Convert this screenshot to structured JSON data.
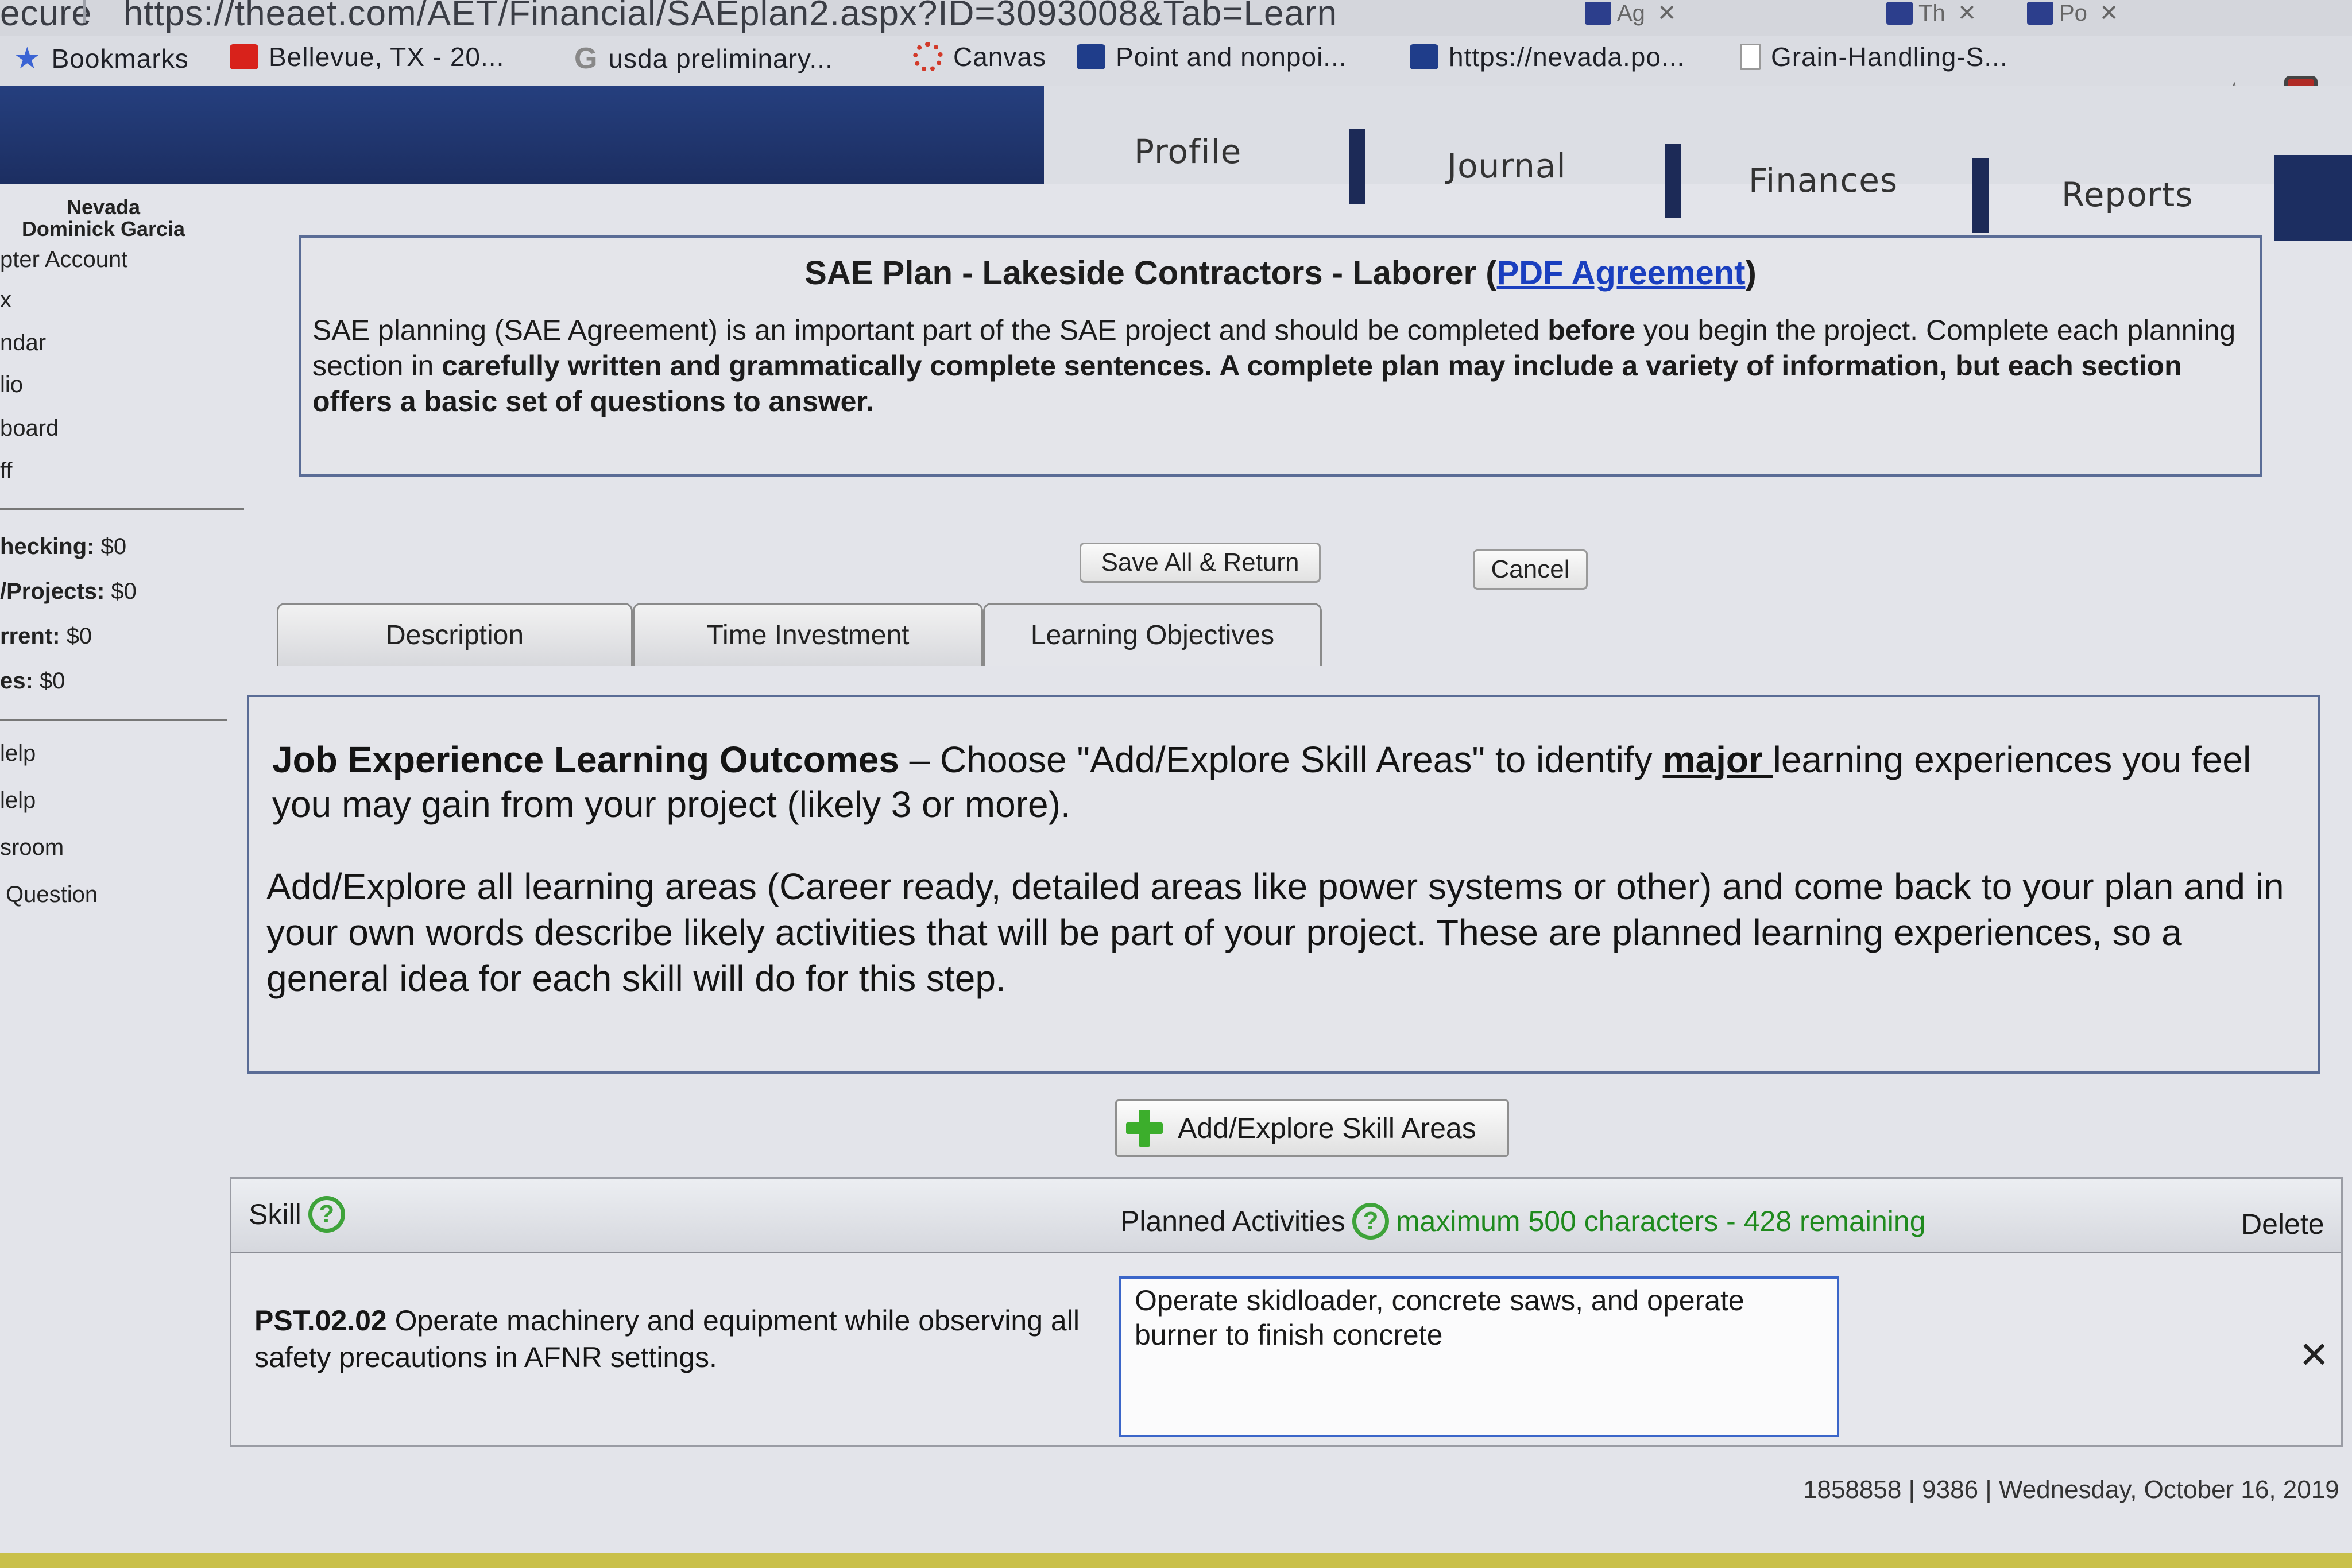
{
  "browser": {
    "url": "https://theaet.com/AET/Financial/SAEplan2.aspx?ID=3093008&Tab=Learn",
    "url_prefix": "ecure",
    "tabs": [
      "Ag",
      "Th",
      "Po"
    ],
    "bookmarks": [
      {
        "label": "Bookmarks",
        "icon": "star-icon"
      },
      {
        "label": "Bellevue, TX - 20...",
        "icon": "youtube-icon"
      },
      {
        "label": "usda preliminary...",
        "icon": "google-icon"
      },
      {
        "label": "Canvas",
        "icon": "canvas-icon"
      },
      {
        "label": "Point and nonpoi...",
        "icon": "site-icon"
      },
      {
        "label": "https://nevada.po...",
        "icon": "site-icon"
      },
      {
        "label": "Grain-Handling-S...",
        "icon": "page-icon"
      }
    ]
  },
  "nav": {
    "tabs": [
      "Profile",
      "Journal",
      "Finances",
      "Reports"
    ]
  },
  "sidebar": {
    "user_line1": "Nevada",
    "user_line2": "Dominick Garcia",
    "links": [
      "pter Account",
      "x",
      "ndar",
      "lio",
      "board",
      "ff"
    ],
    "balances": [
      {
        "label": "hecking:",
        "value": "$0"
      },
      {
        "label": "/Projects:",
        "value": "$0"
      },
      {
        "label": "rrent:",
        "value": "$0"
      },
      {
        "label": "es:",
        "value": "$0"
      }
    ],
    "help_links": [
      "lelp",
      "lelp",
      "sroom",
      "Question"
    ]
  },
  "plan": {
    "title_prefix": "SAE Plan - Lakeside Contractors - Laborer (",
    "title_link": "PDF Agreement",
    "title_suffix": ")",
    "intro_1": "SAE planning (SAE Agreement) is an important part of the SAE project and should be completed ",
    "intro_before": "before",
    "intro_2": " you begin the project. Complete each planning section in ",
    "intro_bold": "carefully written and grammatically complete sentences. A complete plan may include a variety of information, but each section offers a basic set of questions to answer."
  },
  "buttons": {
    "save": "Save All & Return",
    "cancel": "Cancel",
    "add_skill": "Add/Explore Skill Areas"
  },
  "plan_tabs": [
    "Description",
    "Time Investment",
    "Learning Objectives"
  ],
  "learning": {
    "heading": "Job Experience Learning Outcomes",
    "p1_a": " – Choose \"Add/Explore Skill Areas\" to identify ",
    "p1_major": "major ",
    "p1_b": "learning experiences you feel you may gain from your project (likely 3 or more).",
    "p2": "Add/Explore all learning areas (Career ready, detailed areas like power systems or other) and come back to your plan and in your own words describe likely activities that will be part of your project. These are planned learning experiences, so a general idea for each skill will do for this step."
  },
  "skills_table": {
    "col_skill": "Skill",
    "col_activities": "Planned Activities",
    "char_note": "maximum 500 characters - 428 remaining",
    "col_delete": "Delete",
    "rows": [
      {
        "code": "PST.02.02",
        "description": " Operate machinery and equipment while observing all safety precautions in AFNR settings.",
        "activities": "Operate skidloader, concrete saws, and operate burner to finish concrete"
      }
    ]
  },
  "footer": {
    "meta": "1858858 | 9386 | Wednesday, October 16, 2019"
  }
}
